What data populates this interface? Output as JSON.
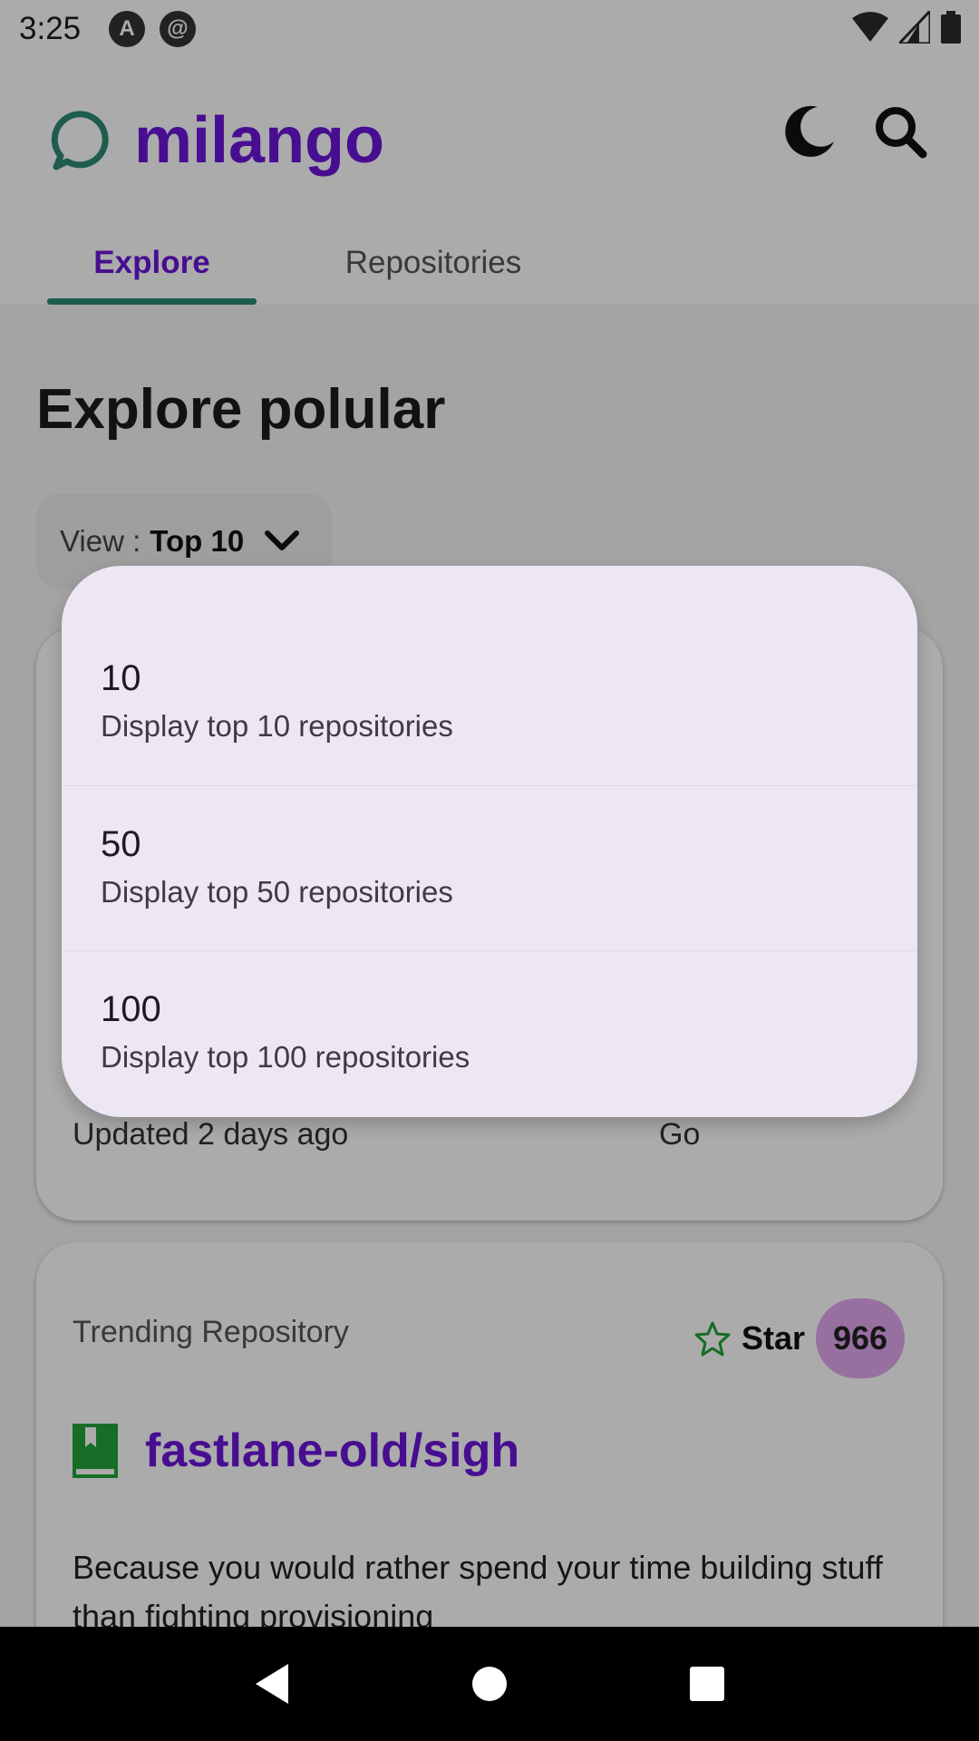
{
  "status_bar": {
    "time": "3:25",
    "icons": [
      "android-auto-icon",
      "at-sign-icon",
      "wifi-icon",
      "cell-signal-icon",
      "battery-icon"
    ]
  },
  "app": {
    "name": "milango",
    "logo_icon": "chat-bubble-icon",
    "actions": [
      "dark-mode-moon-icon",
      "search-icon"
    ]
  },
  "tabs": [
    {
      "label": "Explore",
      "active": true
    },
    {
      "label": "Repositories",
      "active": false
    }
  ],
  "page": {
    "title": "Explore polular",
    "view_select": {
      "prefix": "View :",
      "value": "Top 10"
    }
  },
  "card1": {
    "updated": "Updated 2 days ago",
    "language": "Go"
  },
  "card2": {
    "subtitle": "Trending Repository",
    "star_label": "Star",
    "star_count": "966",
    "repo_name": "fastlane-old/sigh",
    "description": "Because you would rather spend your time building stuff than fighting provisioning"
  },
  "menu": {
    "items": [
      {
        "title": "10",
        "subtitle": "Display top 10 repositories"
      },
      {
        "title": "50",
        "subtitle": "Display top 50 repositories"
      },
      {
        "title": "100",
        "subtitle": "Display top 100 repositories"
      }
    ]
  },
  "nav": [
    "back-icon",
    "home-icon",
    "recents-icon"
  ],
  "colors": {
    "brand": "#6a16d9",
    "tab_indicator": "#2e8b75",
    "menu_bg": "#ede7f3",
    "star_badge": "#e2a8ef",
    "star_icon": "#22a33a"
  }
}
